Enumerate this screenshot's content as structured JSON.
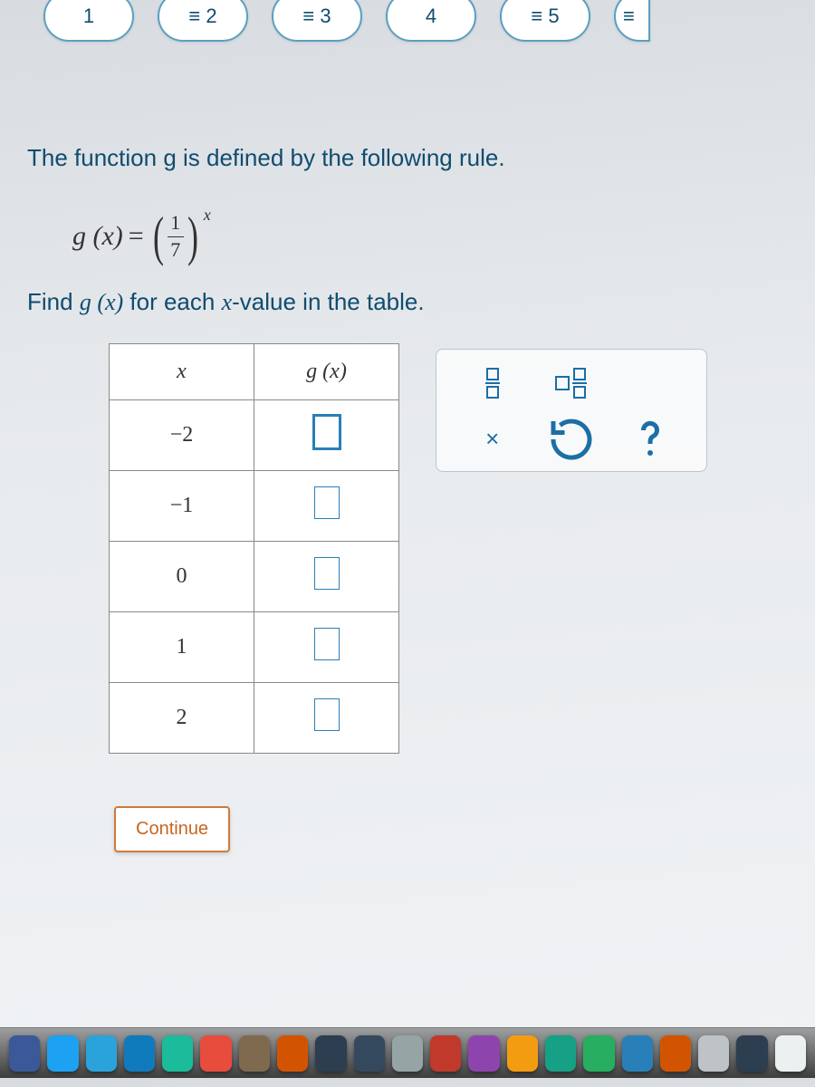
{
  "nav": {
    "items": [
      {
        "label": "1",
        "state": "current"
      },
      {
        "label": "≡ 2",
        "state": "normal"
      },
      {
        "label": "≡ 3",
        "state": "normal"
      },
      {
        "label": "4",
        "state": "normal"
      },
      {
        "label": "≡ 5",
        "state": "normal"
      },
      {
        "label": "≡",
        "state": "partial"
      }
    ]
  },
  "question": {
    "intro": "The function g is defined by the following rule.",
    "formula": {
      "lhs": "g (x)",
      "eq": "=",
      "frac_num": "1",
      "frac_den": "7",
      "exp": "x"
    },
    "instruction_prefix": "Find ",
    "instruction_fn": "g (x)",
    "instruction_mid": " for each ",
    "instruction_var": "x",
    "instruction_suffix": "-value in the table."
  },
  "table": {
    "headers": {
      "x": "x",
      "gx": "g (x)"
    },
    "rows": [
      {
        "x": "−2",
        "active": true
      },
      {
        "x": "−1",
        "active": false
      },
      {
        "x": "0",
        "active": false
      },
      {
        "x": "1",
        "active": false
      },
      {
        "x": "2",
        "active": false
      }
    ]
  },
  "toolbox": {
    "fraction": "fraction",
    "mixed": "mixed-number",
    "clear": "×",
    "reset": "↺",
    "help": "?"
  },
  "buttons": {
    "continue": "Continue"
  },
  "dock_colors": [
    "#3b5998",
    "#1da1f2",
    "#2aa3dc",
    "#0f7bbd",
    "#1abc9c",
    "#e74c3c",
    "#7f6a4f",
    "#d35400",
    "#2c3e50",
    "#34495e",
    "#95a5a6",
    "#c0392b",
    "#8e44ad",
    "#f39c12",
    "#16a085",
    "#27ae60",
    "#2980b9",
    "#d35400",
    "#bdc3c7",
    "#2c3e50",
    "#ecf0f1"
  ]
}
